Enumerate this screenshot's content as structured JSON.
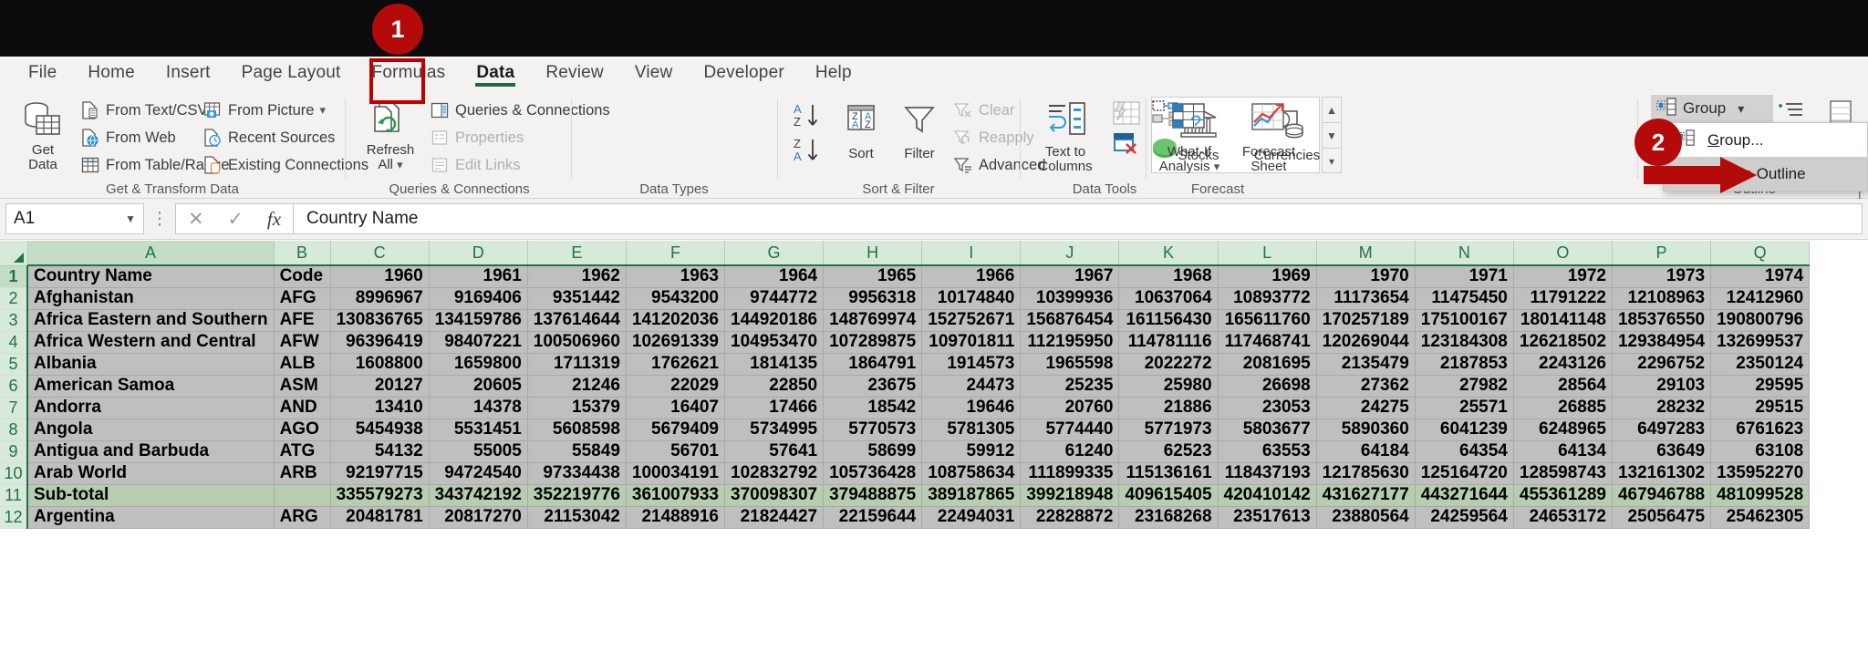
{
  "app": {
    "title": "Microsoft Excel"
  },
  "ribbon": {
    "tabs": [
      {
        "label": "File",
        "active": false
      },
      {
        "label": "Home",
        "active": false
      },
      {
        "label": "Insert",
        "active": false
      },
      {
        "label": "Page Layout",
        "active": false
      },
      {
        "label": "Formulas",
        "active": false
      },
      {
        "label": "Data",
        "active": true
      },
      {
        "label": "Review",
        "active": false
      },
      {
        "label": "View",
        "active": false
      },
      {
        "label": "Developer",
        "active": false
      },
      {
        "label": "Help",
        "active": false
      }
    ],
    "groups": [
      {
        "name": "Get & Transform Data",
        "label": "Get & Transform Data",
        "big": [
          {
            "label": "Get\nData",
            "icon": "get-data-icon"
          }
        ],
        "items": [
          {
            "label": "From Text/CSV",
            "icon": "from-text-csv-icon",
            "disabled": false
          },
          {
            "label": "From Web",
            "icon": "from-web-icon",
            "disabled": false
          },
          {
            "label": "From Table/Range",
            "icon": "from-table-range-icon",
            "disabled": false
          },
          {
            "label": "From Picture",
            "icon": "from-picture-icon",
            "disabled": false,
            "chevron": true
          },
          {
            "label": "Recent Sources",
            "icon": "recent-sources-icon",
            "disabled": false
          },
          {
            "label": "Existing Connections",
            "icon": "existing-connections-icon",
            "disabled": false
          }
        ]
      },
      {
        "name": "Queries & Connections",
        "label": "Queries & Connections",
        "big": [
          {
            "label": "Refresh\nAll",
            "icon": "refresh-all-icon",
            "chevron": true
          }
        ],
        "items": [
          {
            "label": "Queries & Connections",
            "icon": "queries-connections-icon",
            "disabled": false
          },
          {
            "label": "Properties",
            "icon": "properties-icon",
            "disabled": true
          },
          {
            "label": "Edit Links",
            "icon": "edit-links-icon",
            "disabled": true
          }
        ]
      },
      {
        "name": "Data Types",
        "label": "Data Types",
        "big": [
          {
            "label": "Stocks",
            "icon": "stocks-icon"
          },
          {
            "label": "Currencies",
            "icon": "currencies-icon"
          }
        ],
        "items": []
      },
      {
        "name": "Sort & Filter",
        "label": "Sort & Filter",
        "big": [
          {
            "label": "Sort",
            "icon": "sort-dialog-icon"
          },
          {
            "label": "Filter",
            "icon": "filter-icon"
          }
        ],
        "items": [
          {
            "label": "Clear",
            "icon": "clear-filter-icon",
            "disabled": true
          },
          {
            "label": "Reapply",
            "icon": "reapply-filter-icon",
            "disabled": true
          },
          {
            "label": "Advanced",
            "icon": "advanced-filter-icon",
            "disabled": false
          }
        ]
      },
      {
        "name": "Data Tools",
        "label": "Data Tools",
        "big": [
          {
            "label": "Text to\nColumns",
            "icon": "text-to-columns-icon"
          }
        ],
        "items": []
      },
      {
        "name": "Forecast",
        "label": "Forecast",
        "big": [
          {
            "label": "What-If\nAnalysis",
            "icon": "what-if-analysis-icon",
            "chevron": true
          },
          {
            "label": "Forecast\nSheet",
            "icon": "forecast-sheet-icon"
          }
        ],
        "items": []
      },
      {
        "name": "Outline",
        "label": "Outline",
        "big": [],
        "items": []
      }
    ],
    "outline": {
      "group_button": "Group",
      "menu": [
        {
          "label": "Group...",
          "underline": "G",
          "rest": "roup...",
          "highlighted": false,
          "icon": "group-icon"
        },
        {
          "label": "Auto Outline",
          "underline": "A",
          "rest": "uto Outline",
          "highlighted": true,
          "icon": ""
        }
      ]
    }
  },
  "formula_bar": {
    "name_box": "A1",
    "cancel_icon": "cancel-icon",
    "enter_icon": "enter-icon",
    "fx_icon": "fx-icon",
    "value": "Country Name"
  },
  "sheet": {
    "column_headers": [
      "A",
      "B",
      "C",
      "D",
      "E",
      "F",
      "G",
      "H",
      "I",
      "J",
      "K",
      "L",
      "M",
      "N",
      "O",
      "P",
      "Q"
    ],
    "selected_column": "A",
    "row_numbers": [
      "1",
      "2",
      "3",
      "4",
      "5",
      "6",
      "7",
      "8",
      "9",
      "10",
      "11",
      "12"
    ],
    "selected_row": "1",
    "rows": [
      {
        "r": "1",
        "header": true,
        "cells": [
          "Country Name",
          "Code",
          "1960",
          "1961",
          "1962",
          "1963",
          "1964",
          "1965",
          "1966",
          "1967",
          "1968",
          "1969",
          "1970",
          "1971",
          "1972",
          "1973",
          "1974"
        ]
      },
      {
        "r": "2",
        "cells": [
          "Afghanistan",
          "AFG",
          "8996967",
          "9169406",
          "9351442",
          "9543200",
          "9744772",
          "9956318",
          "10174840",
          "10399936",
          "10637064",
          "10893772",
          "11173654",
          "11475450",
          "11791222",
          "12108963",
          "12412960"
        ]
      },
      {
        "r": "3",
        "cells": [
          "Africa Eastern and Southern",
          "AFE",
          "130836765",
          "134159786",
          "137614644",
          "141202036",
          "144920186",
          "148769974",
          "152752671",
          "156876454",
          "161156430",
          "165611760",
          "170257189",
          "175100167",
          "180141148",
          "185376550",
          "190800796"
        ]
      },
      {
        "r": "4",
        "cells": [
          "Africa Western and Central",
          "AFW",
          "96396419",
          "98407221",
          "100506960",
          "102691339",
          "104953470",
          "107289875",
          "109701811",
          "112195950",
          "114781116",
          "117468741",
          "120269044",
          "123184308",
          "126218502",
          "129384954",
          "132699537"
        ]
      },
      {
        "r": "5",
        "cells": [
          "Albania",
          "ALB",
          "1608800",
          "1659800",
          "1711319",
          "1762621",
          "1814135",
          "1864791",
          "1914573",
          "1965598",
          "2022272",
          "2081695",
          "2135479",
          "2187853",
          "2243126",
          "2296752",
          "2350124"
        ]
      },
      {
        "r": "6",
        "cells": [
          "American Samoa",
          "ASM",
          "20127",
          "20605",
          "21246",
          "22029",
          "22850",
          "23675",
          "24473",
          "25235",
          "25980",
          "26698",
          "27362",
          "27982",
          "28564",
          "29103",
          "29595"
        ]
      },
      {
        "r": "7",
        "cells": [
          "Andorra",
          "AND",
          "13410",
          "14378",
          "15379",
          "16407",
          "17466",
          "18542",
          "19646",
          "20760",
          "21886",
          "23053",
          "24275",
          "25571",
          "26885",
          "28232",
          "29515"
        ]
      },
      {
        "r": "8",
        "cells": [
          "Angola",
          "AGO",
          "5454938",
          "5531451",
          "5608598",
          "5679409",
          "5734995",
          "5770573",
          "5781305",
          "5774440",
          "5771973",
          "5803677",
          "5890360",
          "6041239",
          "6248965",
          "6497283",
          "6761623"
        ]
      },
      {
        "r": "9",
        "cells": [
          "Antigua and Barbuda",
          "ATG",
          "54132",
          "55005",
          "55849",
          "56701",
          "57641",
          "58699",
          "59912",
          "61240",
          "62523",
          "63553",
          "64184",
          "64354",
          "64134",
          "63649",
          "63108"
        ]
      },
      {
        "r": "10",
        "cells": [
          "Arab World",
          "ARB",
          "92197715",
          "94724540",
          "97334438",
          "100034191",
          "102832792",
          "105736428",
          "108758634",
          "111899335",
          "115136161",
          "118437193",
          "121785630",
          "125164720",
          "128598743",
          "132161302",
          "135952270"
        ]
      },
      {
        "r": "11",
        "subtotal": true,
        "cells": [
          "Sub-total",
          "",
          "335579273",
          "343742192",
          "352219776",
          "361007933",
          "370098307",
          "379488875",
          "389187865",
          "399218948",
          "409615405",
          "420410142",
          "431627177",
          "443271644",
          "455361289",
          "467946788",
          "481099528"
        ]
      },
      {
        "r": "12",
        "cells": [
          "Argentina",
          "ARG",
          "20481781",
          "20817270",
          "21153042",
          "21488916",
          "21824427",
          "22159644",
          "22494031",
          "22828872",
          "23168268",
          "23517613",
          "23880564",
          "24259564",
          "24653172",
          "25056475",
          "25462305"
        ]
      }
    ]
  },
  "annotations": {
    "step1": "1",
    "step2": "2",
    "accent_color": "#b40a0a",
    "excel_green": "#217346"
  }
}
